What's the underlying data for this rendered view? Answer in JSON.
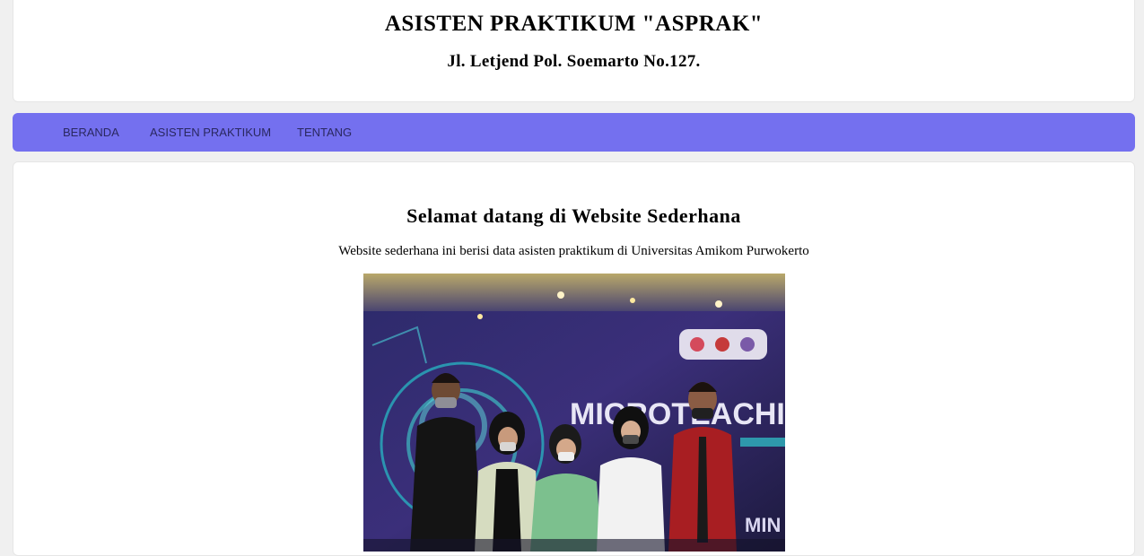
{
  "header": {
    "title": "ASISTEN PRAKTIKUM \"ASPRAK\"",
    "address": "Jl. Letjend Pol. Soemarto No.127."
  },
  "nav": {
    "items": [
      {
        "label": "BERANDA"
      },
      {
        "label": "ASISTEN PRAKTIKUM"
      },
      {
        "label": "TENTANG"
      }
    ]
  },
  "main": {
    "heading": "Selamat datang di Website Sederhana",
    "description": "Website sederhana ini berisi data asisten praktikum di Universitas Amikom Purwokerto",
    "photo": {
      "banner_text": "MICROTEACHING",
      "banner_side_text": "MIN"
    }
  },
  "colors": {
    "navbar": "#7470ef",
    "nav_text": "#2a2860",
    "background": "#f0f0f0"
  }
}
